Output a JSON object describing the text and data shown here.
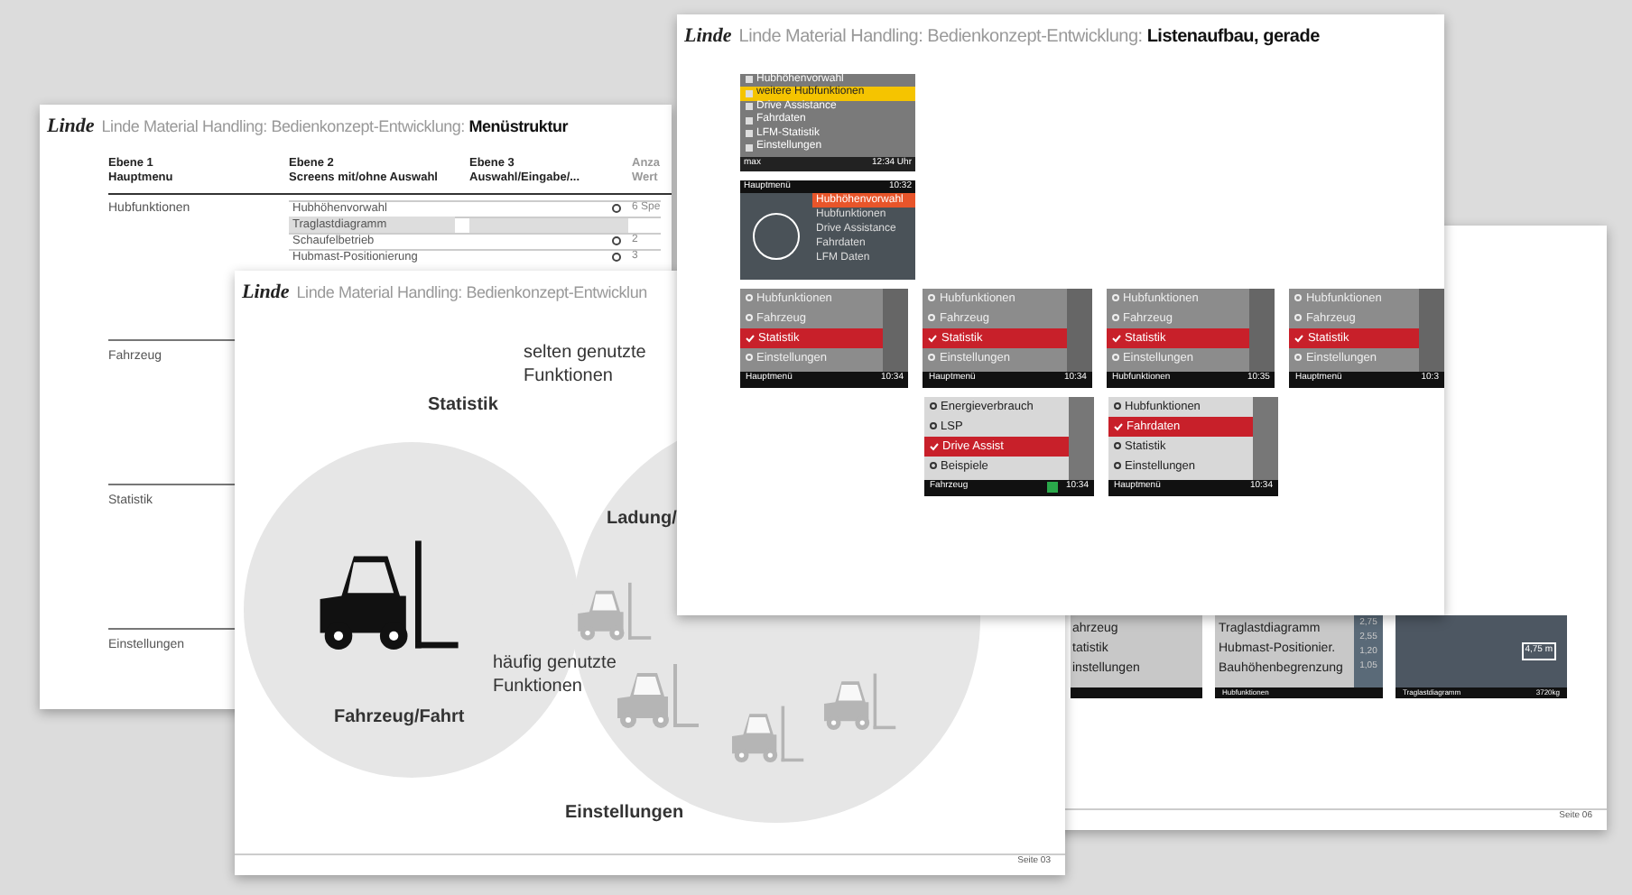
{
  "slides": [
    {
      "kind": "table",
      "logo": "Linde",
      "title": "Linde Material Handling: Bedienkonzept-Entwicklung: ",
      "title_bold": "Menüstruktur",
      "columns": [
        {
          "line1": "Ebene 1",
          "line2": "Hauptmenu"
        },
        {
          "line1": "Ebene 2",
          "line2": "Screens mit/ohne Auswahl"
        },
        {
          "line1": "Ebene 3",
          "line2": "Auswahl/Eingabe/..."
        },
        {
          "line1": "Anza",
          "line2": "Wert"
        }
      ],
      "sections": [
        {
          "label": "Hubfunktionen",
          "rows": [
            {
              "name": "Hubhöhenvorwahl",
              "shaded": false,
              "circle": true,
              "value": "6 Spe"
            },
            {
              "name": "Traglastdiagramm",
              "shaded": true,
              "circle": false
            },
            {
              "name": "Schaufelbetrieb",
              "shaded": false,
              "circle": true,
              "value": "2"
            },
            {
              "name": "Hubmast-Positionierung",
              "shaded": false,
              "circle": true,
              "value": "3"
            }
          ]
        },
        {
          "label": "Fahrzeug"
        },
        {
          "label": "Statistik"
        },
        {
          "label": "Einstellungen"
        }
      ]
    },
    {
      "kind": "back",
      "page": "Seite 06",
      "screens": [
        {
          "items": [
            "ahrzeug",
            "tatistik",
            "instellungen"
          ]
        },
        {
          "items": [
            "Traglastdiagramm",
            "Hubmast-Positionier.",
            "Bauhöhenbegrenzung"
          ],
          "values": [
            "2,75",
            "2,55",
            "1,20",
            "1,05"
          ],
          "footer": "Hubfunktionen"
        },
        {
          "chart_label": "4,75 m",
          "footer": "Traglastdiagramm",
          "footer_right": "3720kg"
        }
      ]
    },
    {
      "kind": "venn",
      "logo": "Linde",
      "title": "Linde Material Handling: Bedienkonzept-Entwicklun",
      "page": "Seite 03",
      "labels": [
        {
          "text": "selten genutzte Funktionen",
          "bold": false
        },
        {
          "text": "Statistik",
          "bold": true
        },
        {
          "text": "Ladung/",
          "bold": true
        },
        {
          "text": "häufig genutzte Funktionen",
          "bold": false
        },
        {
          "text": "Fahrzeug/Fahrt",
          "bold": true
        },
        {
          "text": "Einstellungen",
          "bold": true
        }
      ]
    },
    {
      "kind": "screens",
      "logo": "Linde",
      "title": "Linde Material Handling: Bedienkonzept-Entwicklung: ",
      "title_bold": "Listenaufbau, gerade",
      "rows": [
        [
          {
            "kind": "yellow",
            "items": [
              {
                "label": "Hubhöhenvorwahl",
                "selected": false
              },
              {
                "label": "weitere Hubfunktionen",
                "selected": true
              },
              {
                "label": "Drive Assistance",
                "selected": false
              },
              {
                "label": "Fahrdaten",
                "selected": false
              },
              {
                "label": "LFM-Statistik",
                "selected": false
              },
              {
                "label": "Einstellungen",
                "selected": false
              }
            ],
            "footer": "max",
            "footer_right": "12:34 Uhr"
          }
        ],
        [
          {
            "kind": "dark",
            "header": "Hauptmenü",
            "header_right": "10:32",
            "items": [
              {
                "label": "Hubhöhenvorwahl",
                "selected": true
              },
              {
                "label": "Hubfunktionen",
                "selected": false
              },
              {
                "label": "Drive Assistance",
                "selected": false
              },
              {
                "label": "Fahrdaten",
                "selected": false
              },
              {
                "label": "LFM Daten",
                "selected": false
              }
            ]
          }
        ],
        [
          {
            "kind": "grey",
            "items": [
              {
                "label": "Hubfunktionen",
                "selected": false
              },
              {
                "label": "Fahrzeug",
                "selected": false
              },
              {
                "label": "Statistik",
                "selected": true
              },
              {
                "label": "Einstellungen",
                "selected": false
              }
            ],
            "footer": "Hauptmenü",
            "footer_right": "10:34"
          },
          {
            "kind": "grey",
            "items": [
              {
                "label": "Hubfunktionen",
                "selected": false
              },
              {
                "label": "Fahrzeug",
                "selected": false
              },
              {
                "label": "Statistik",
                "selected": true
              },
              {
                "label": "Einstellungen",
                "selected": false
              }
            ],
            "footer": "Hauptmenü",
            "footer_right": "10:34"
          },
          {
            "kind": "icons",
            "items": [
              {
                "label": "Hubfunktionen",
                "selected": false
              },
              {
                "label": "Fahrzeug",
                "selected": false
              },
              {
                "label": "Statistik",
                "selected": true
              },
              {
                "label": "Einstellungen",
                "selected": false
              }
            ],
            "footer": "Hubfunktionen",
            "footer_right": "10:35"
          },
          {
            "kind": "grey",
            "items": [
              {
                "label": "Hubfunktionen",
                "selected": false
              },
              {
                "label": "Fahrzeug",
                "selected": false
              },
              {
                "label": "Statistik",
                "selected": true
              },
              {
                "label": "Einstellungen",
                "selected": false
              }
            ],
            "footer": "Hauptmenü",
            "footer_right": "10:3"
          }
        ],
        [
          {
            "kind": "spacer"
          },
          {
            "kind": "light",
            "items": [
              {
                "label": "Energieverbrauch",
                "selected": false
              },
              {
                "label": "LSP",
                "selected": false
              },
              {
                "label": "Drive Assist",
                "selected": true
              },
              {
                "label": "Beispiele",
                "selected": false
              }
            ],
            "footer": "Fahrzeug",
            "footer_right": "10:34",
            "badge": true
          },
          {
            "kind": "light",
            "items": [
              {
                "label": "Hubfunktionen",
                "selected": false
              },
              {
                "label": "Fahrdaten",
                "selected": true
              },
              {
                "label": "Statistik",
                "selected": false
              },
              {
                "label": "Einstellungen",
                "selected": false
              }
            ],
            "footer": "Hauptmenü",
            "footer_right": "10:34",
            "badge": false
          }
        ]
      ]
    }
  ]
}
